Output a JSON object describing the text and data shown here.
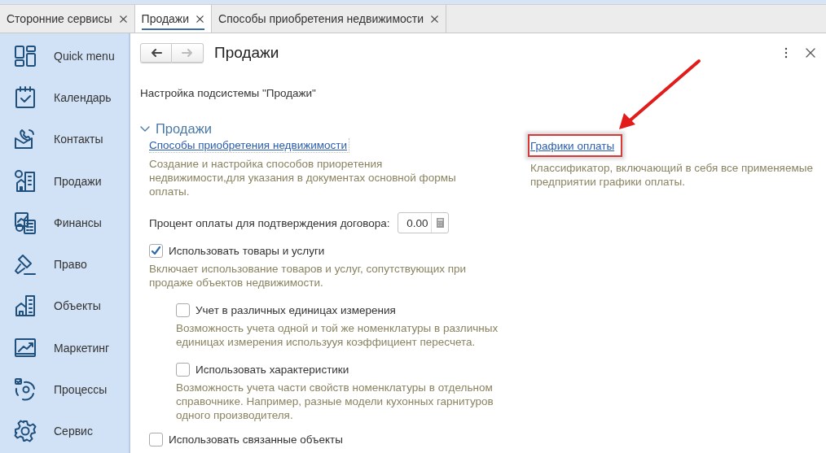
{
  "tabs": [
    {
      "label": "Сторонние сервисы",
      "selected": false
    },
    {
      "label": "Продажи",
      "selected": true
    },
    {
      "label": "Способы приобретения недвижимости",
      "selected": false
    }
  ],
  "sidebar": {
    "items": [
      {
        "label": "Quick menu"
      },
      {
        "label": "Календарь"
      },
      {
        "label": "Контакты"
      },
      {
        "label": "Продажи"
      },
      {
        "label": "Финансы"
      },
      {
        "label": "Право"
      },
      {
        "label": "Объекты"
      },
      {
        "label": "Маркетинг"
      },
      {
        "label": "Процессы"
      },
      {
        "label": "Сервис"
      }
    ]
  },
  "form": {
    "title": "Продажи",
    "back_disabled": false,
    "forward_disabled": true,
    "subtitle": "Настройка подсистемы \"Продажи\"",
    "section": {
      "title": "Продажи",
      "expanded": true,
      "left": [
        {
          "kind": "link",
          "text": "Способы приобретения недвижимости",
          "highlighted": false,
          "description": "Создание и настройка способов приоретения недвижимости,для указания в документах основной формы оплаты."
        },
        {
          "kind": "number",
          "label": "Процент оплаты для подтверждения договора:",
          "value": "0.00"
        },
        {
          "kind": "checkbox",
          "label": "Использовать товары и услуги",
          "checked": true,
          "description": "Включает использование товаров и услуг, сопутствующих при продаже объектов недвижимости.",
          "children": [
            {
              "kind": "checkbox",
              "label": "Учет в различных единицах измерения",
              "checked": false,
              "description": "Возможность учета одной и той же номенклатуры в различных единицах измерения использууя коэффициент пересчета."
            },
            {
              "kind": "checkbox",
              "label": "Использовать характеристики",
              "checked": false,
              "description": "Возможность учета части свойств номенклатуры в отдельном справочнике. Например, разные модели кухонных гарнитуров одного производителя."
            }
          ]
        },
        {
          "kind": "checkbox",
          "label": "Использовать связанные объекты",
          "checked": false
        }
      ],
      "right": [
        {
          "kind": "link",
          "text": "Графики оплаты",
          "highlighted": true,
          "description": "Классификатор, включающий в себя все применяемые\nпредприятии графики оплаты."
        }
      ]
    }
  }
}
